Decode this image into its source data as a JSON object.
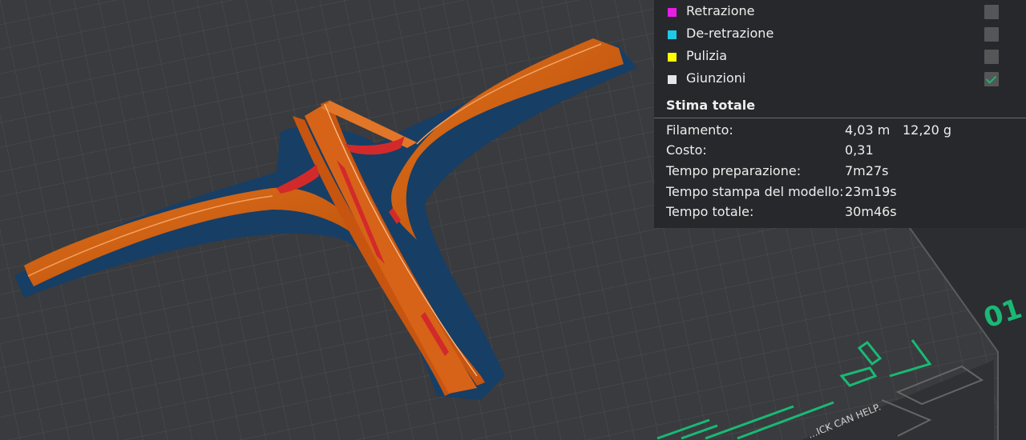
{
  "legend": {
    "items": [
      {
        "label": "Retrazione",
        "color": "#e61ee6",
        "checked": false
      },
      {
        "label": "De-retrazione",
        "color": "#1ec8e6",
        "checked": false
      },
      {
        "label": "Pulizia",
        "color": "#ffff00",
        "checked": false
      },
      {
        "label": "Giunzioni",
        "color": "#e6e6e6",
        "checked": true
      }
    ]
  },
  "summary": {
    "title": "Stima totale",
    "rows": [
      {
        "label": "Filamento:",
        "value": "4,03 m",
        "value2": "12,20 g"
      },
      {
        "label": "Costo:",
        "value": "0,31",
        "value2": ""
      },
      {
        "label": "Tempo preparazione:",
        "value": "7m27s",
        "value2": ""
      },
      {
        "label": "Tempo stampa del modello:",
        "value": "23m19s",
        "value2": ""
      },
      {
        "label": "Tempo totale:",
        "value": "30m46s",
        "value2": ""
      }
    ]
  },
  "plate": {
    "marking_text": "...ICK CAN HELP.",
    "marking_number": "01",
    "accent_color": "#19b975"
  },
  "colors": {
    "model_orange": "#d45f10",
    "model_shadow": "#173e65",
    "seam_red": "#d22a2a",
    "grid_line": "#4b4c50"
  }
}
